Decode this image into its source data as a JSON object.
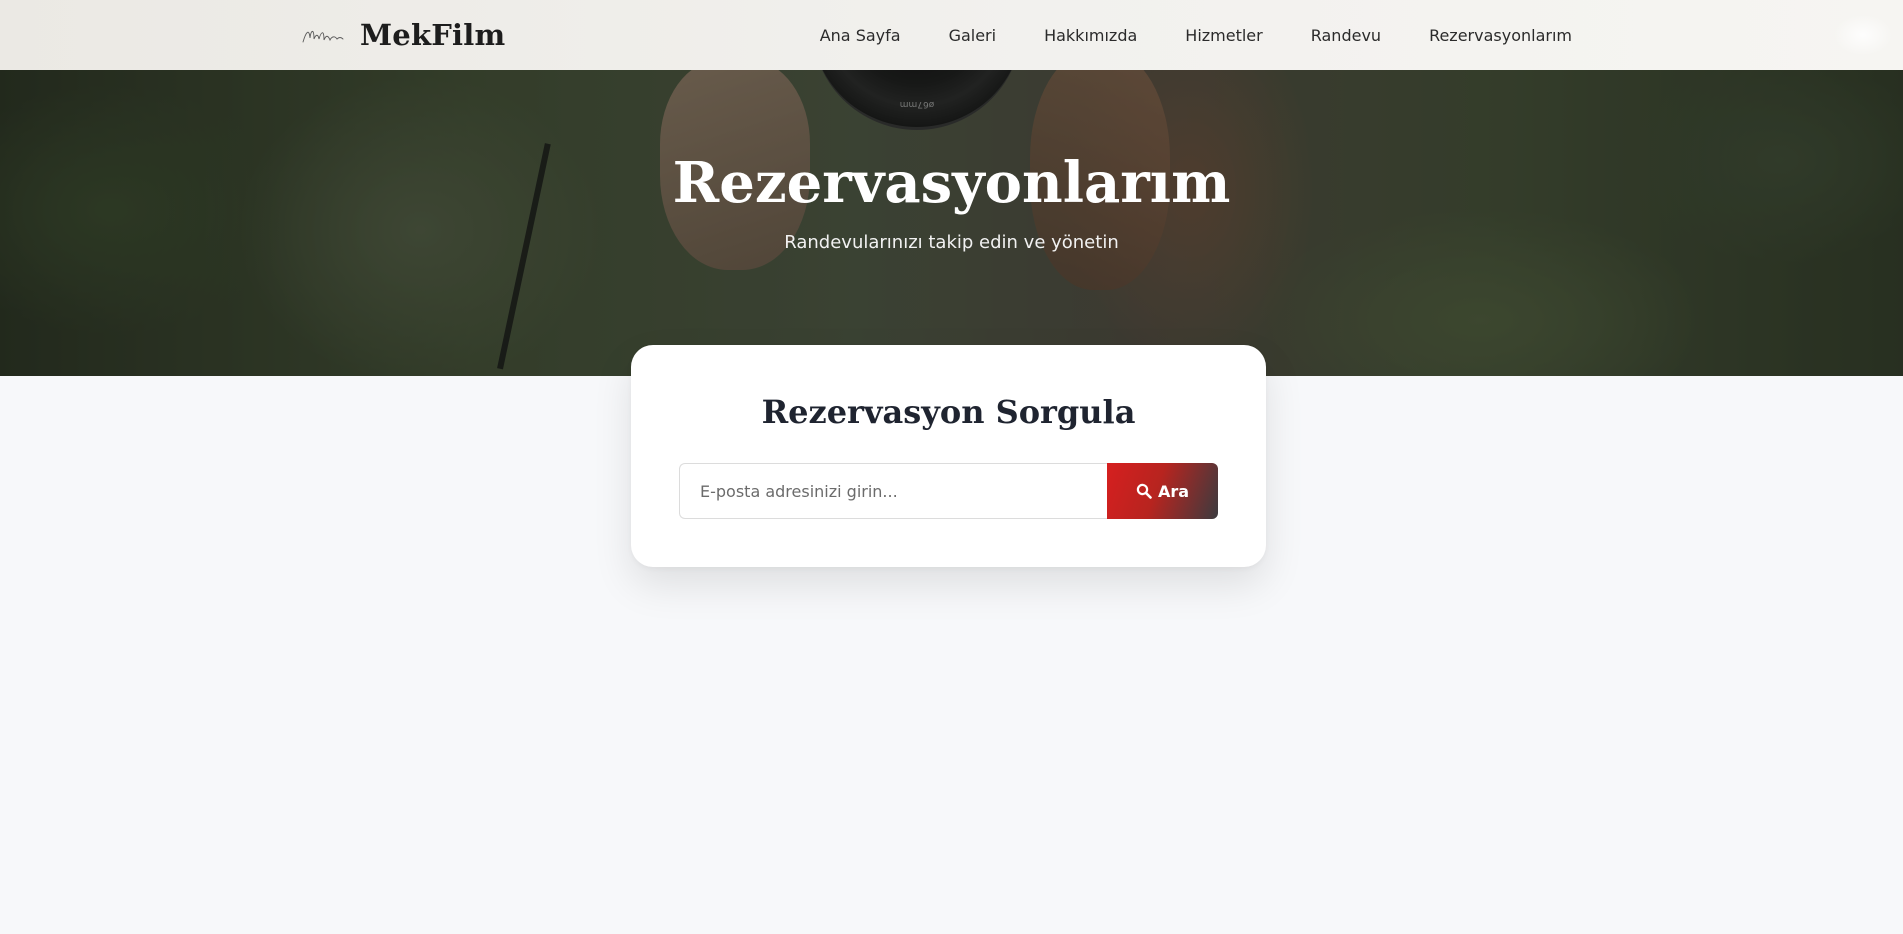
{
  "brand": {
    "name": "MekFilm",
    "logo_icon": "signature-logo-icon"
  },
  "nav": {
    "items": [
      {
        "label": "Ana Sayfa"
      },
      {
        "label": "Galeri"
      },
      {
        "label": "Hakkımızda"
      },
      {
        "label": "Hizmetler"
      },
      {
        "label": "Randevu"
      },
      {
        "label": "Rezervasyonlarım"
      }
    ]
  },
  "hero": {
    "title": "Rezervasyonlarım",
    "subtitle": "Randevularınızı takip edin ve yönetin",
    "lens_label": "ø67mm"
  },
  "search_card": {
    "title": "Rezervasyon Sorgula",
    "input_value": "",
    "input_placeholder": "E-posta adresinizi girin...",
    "button_label": "Ara",
    "button_icon": "search-icon"
  },
  "colors": {
    "accent_red": "#d61f1f",
    "button_dark": "#3b3b3f",
    "page_bg": "#f7f8fa"
  }
}
